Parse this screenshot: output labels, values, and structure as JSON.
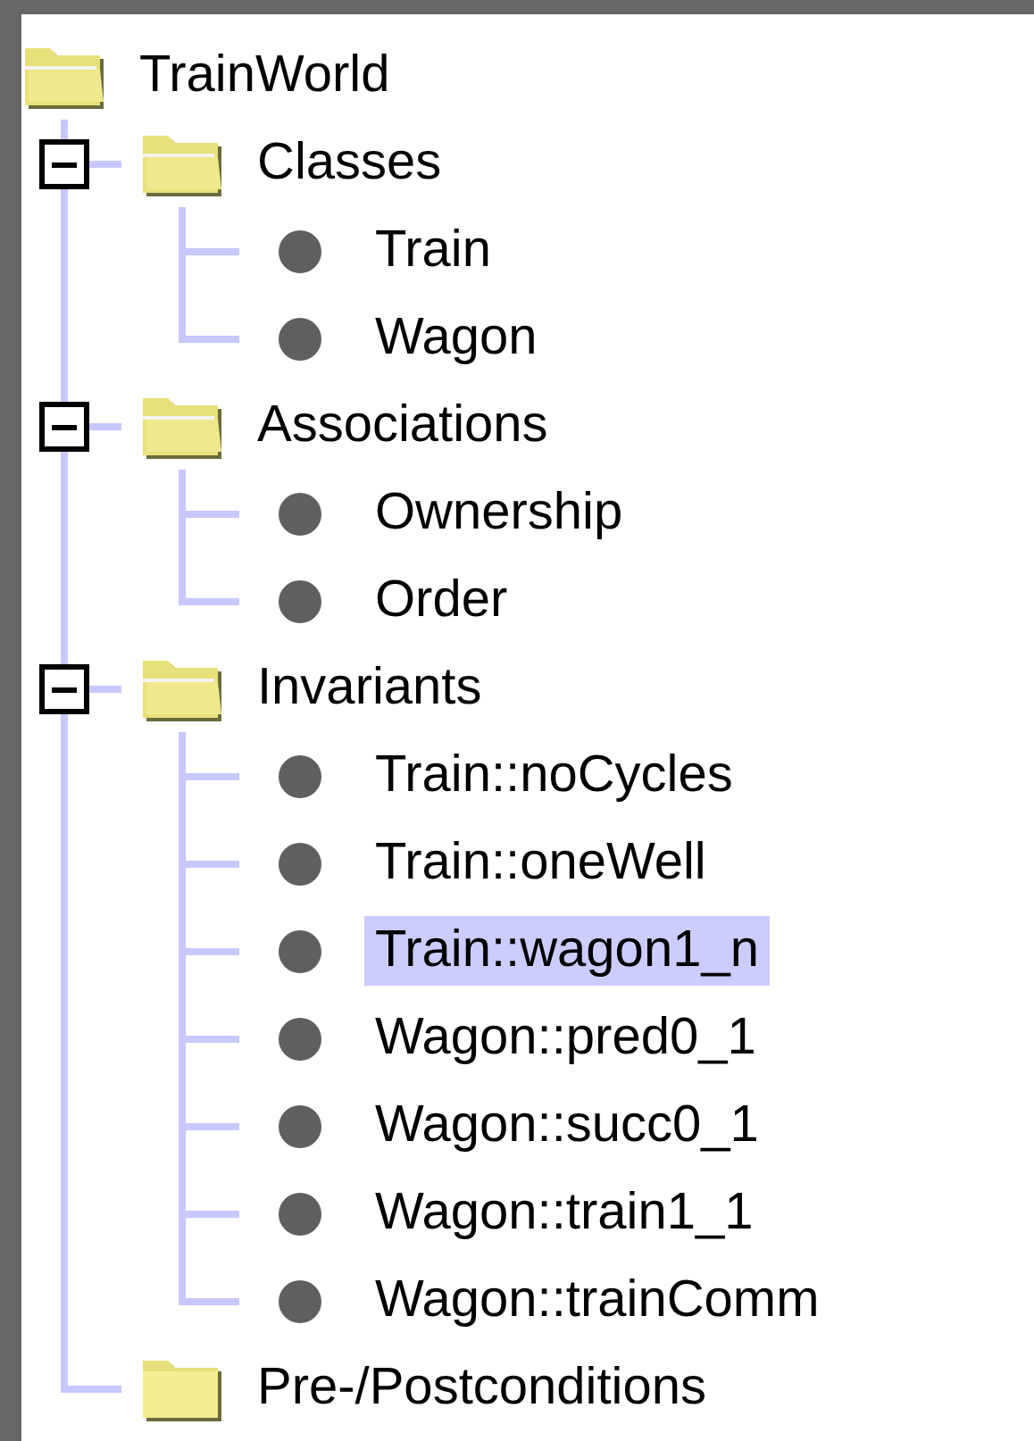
{
  "tree": {
    "label": "TrainWorld",
    "kind": "folder",
    "expanded": true,
    "children": [
      {
        "label": "Classes",
        "kind": "folder",
        "expanded": true,
        "children": [
          {
            "label": "Train",
            "kind": "leaf",
            "selected": false
          },
          {
            "label": "Wagon",
            "kind": "leaf",
            "selected": false
          }
        ]
      },
      {
        "label": "Associations",
        "kind": "folder",
        "expanded": true,
        "children": [
          {
            "label": "Ownership",
            "kind": "leaf",
            "selected": false
          },
          {
            "label": "Order",
            "kind": "leaf",
            "selected": false
          }
        ]
      },
      {
        "label": "Invariants",
        "kind": "folder",
        "expanded": true,
        "children": [
          {
            "label": "Train::noCycles",
            "kind": "leaf",
            "selected": false
          },
          {
            "label": "Train::oneWell",
            "kind": "leaf",
            "selected": false
          },
          {
            "label": "Train::wagon1_n",
            "kind": "leaf",
            "selected": true
          },
          {
            "label": "Wagon::pred0_1",
            "kind": "leaf",
            "selected": false
          },
          {
            "label": "Wagon::succ0_1",
            "kind": "leaf",
            "selected": false
          },
          {
            "label": "Wagon::train1_1",
            "kind": "leaf",
            "selected": false
          },
          {
            "label": "Wagon::trainComm",
            "kind": "leaf",
            "selected": false
          }
        ]
      },
      {
        "label": "Pre-/Postconditions",
        "kind": "folder",
        "expanded": false
      }
    ]
  }
}
